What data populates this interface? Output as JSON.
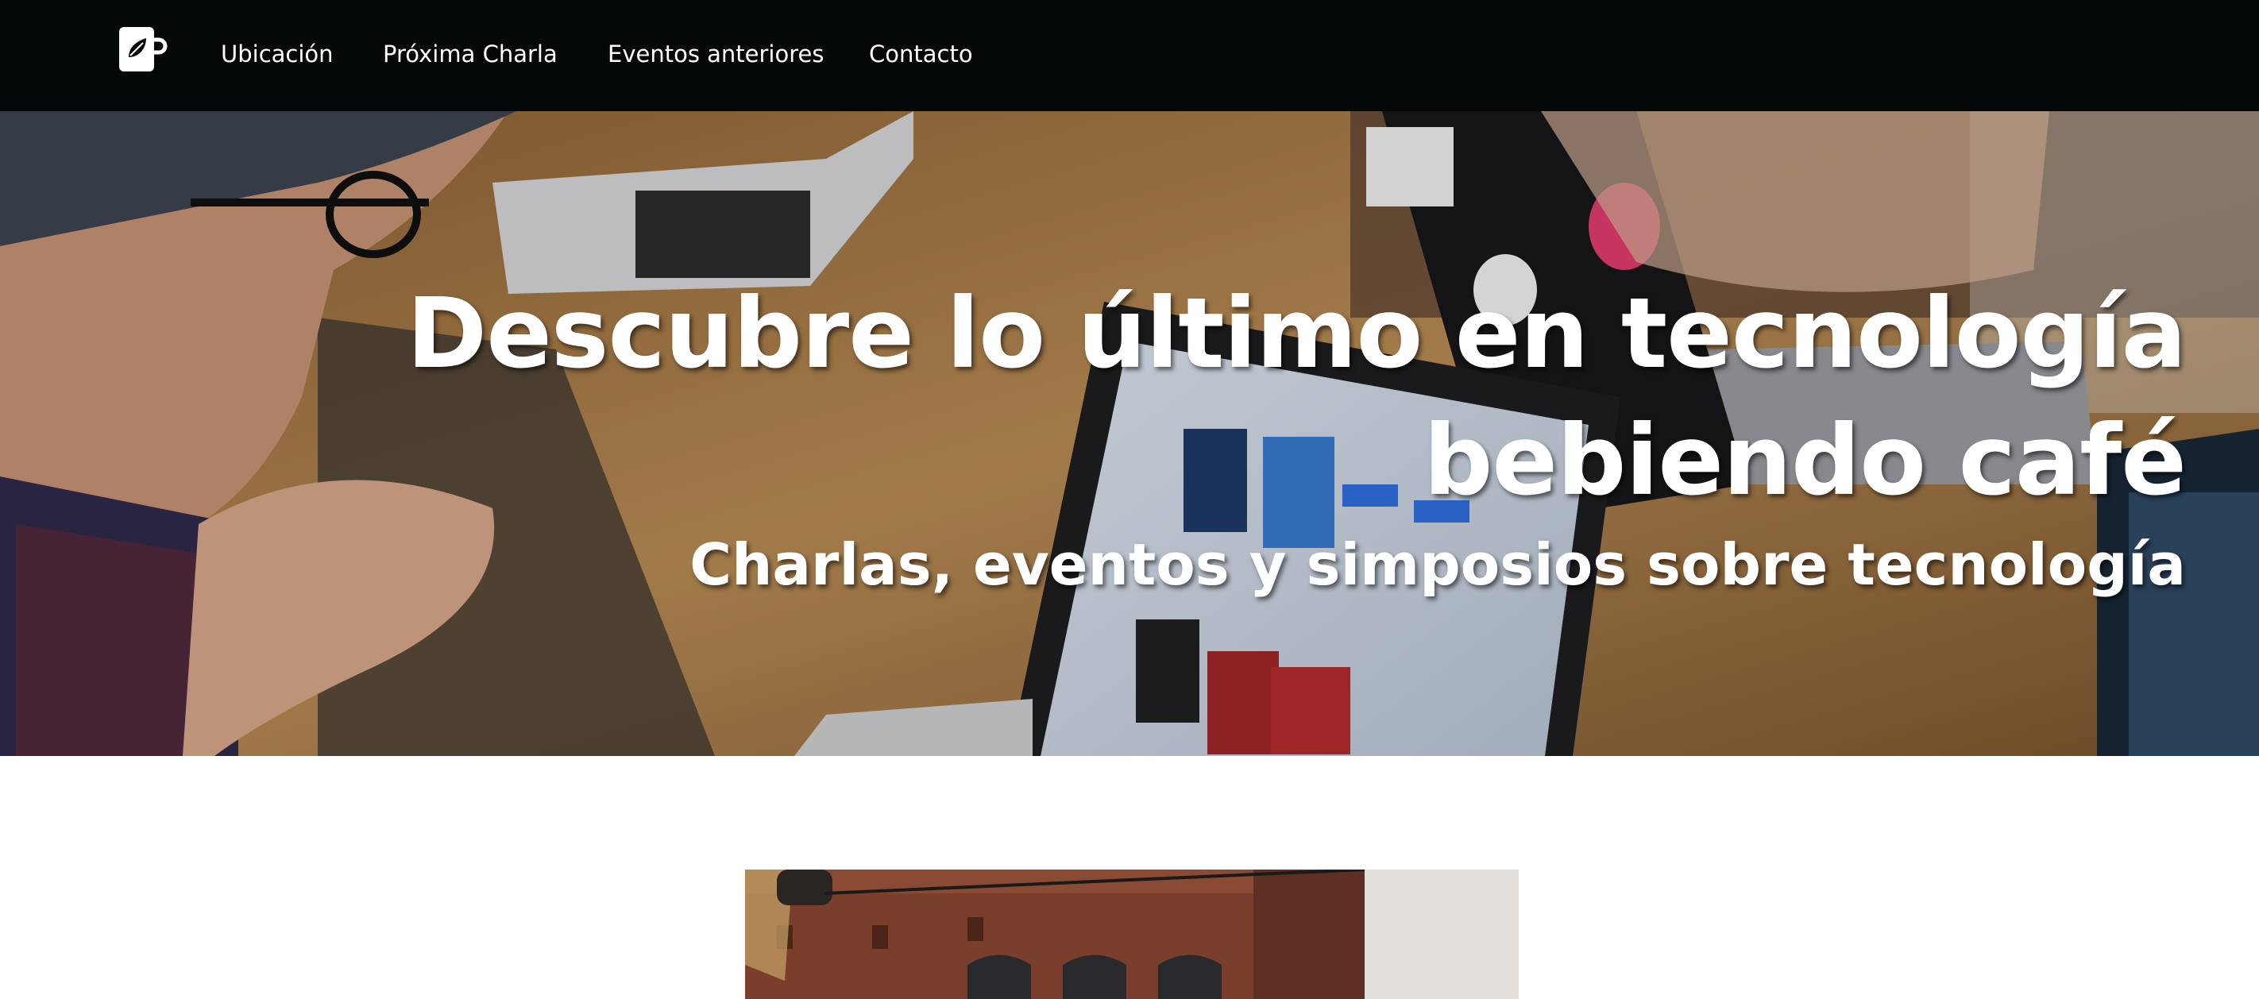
{
  "navbar": {
    "logo_icon": "coffee-cup-leaf-icon",
    "items": [
      {
        "label": "Ubicación"
      },
      {
        "label": "Próxima Charla"
      },
      {
        "label": "Eventos anteriores"
      },
      {
        "label": "Contacto"
      }
    ],
    "background": "#040808"
  },
  "hero": {
    "title": "Descubre lo último en tecnología bebiendo café",
    "subtitle": "Charlas, eventos y simposios sobre tecnología",
    "text_color": "#ffffff"
  }
}
